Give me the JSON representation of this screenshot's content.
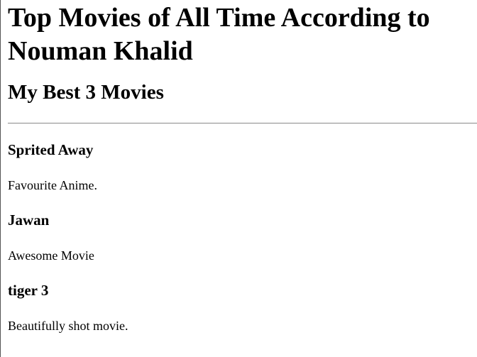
{
  "page": {
    "title": "Top Movies of All Time According to Nouman Khalid",
    "subtitle": "My Best 3 Movies"
  },
  "movies": [
    {
      "name": "Sprited Away",
      "description": "Favourite Anime."
    },
    {
      "name": "Jawan",
      "description": "Awesome Movie"
    },
    {
      "name": "tiger 3",
      "description": "Beautifully shot movie."
    }
  ]
}
